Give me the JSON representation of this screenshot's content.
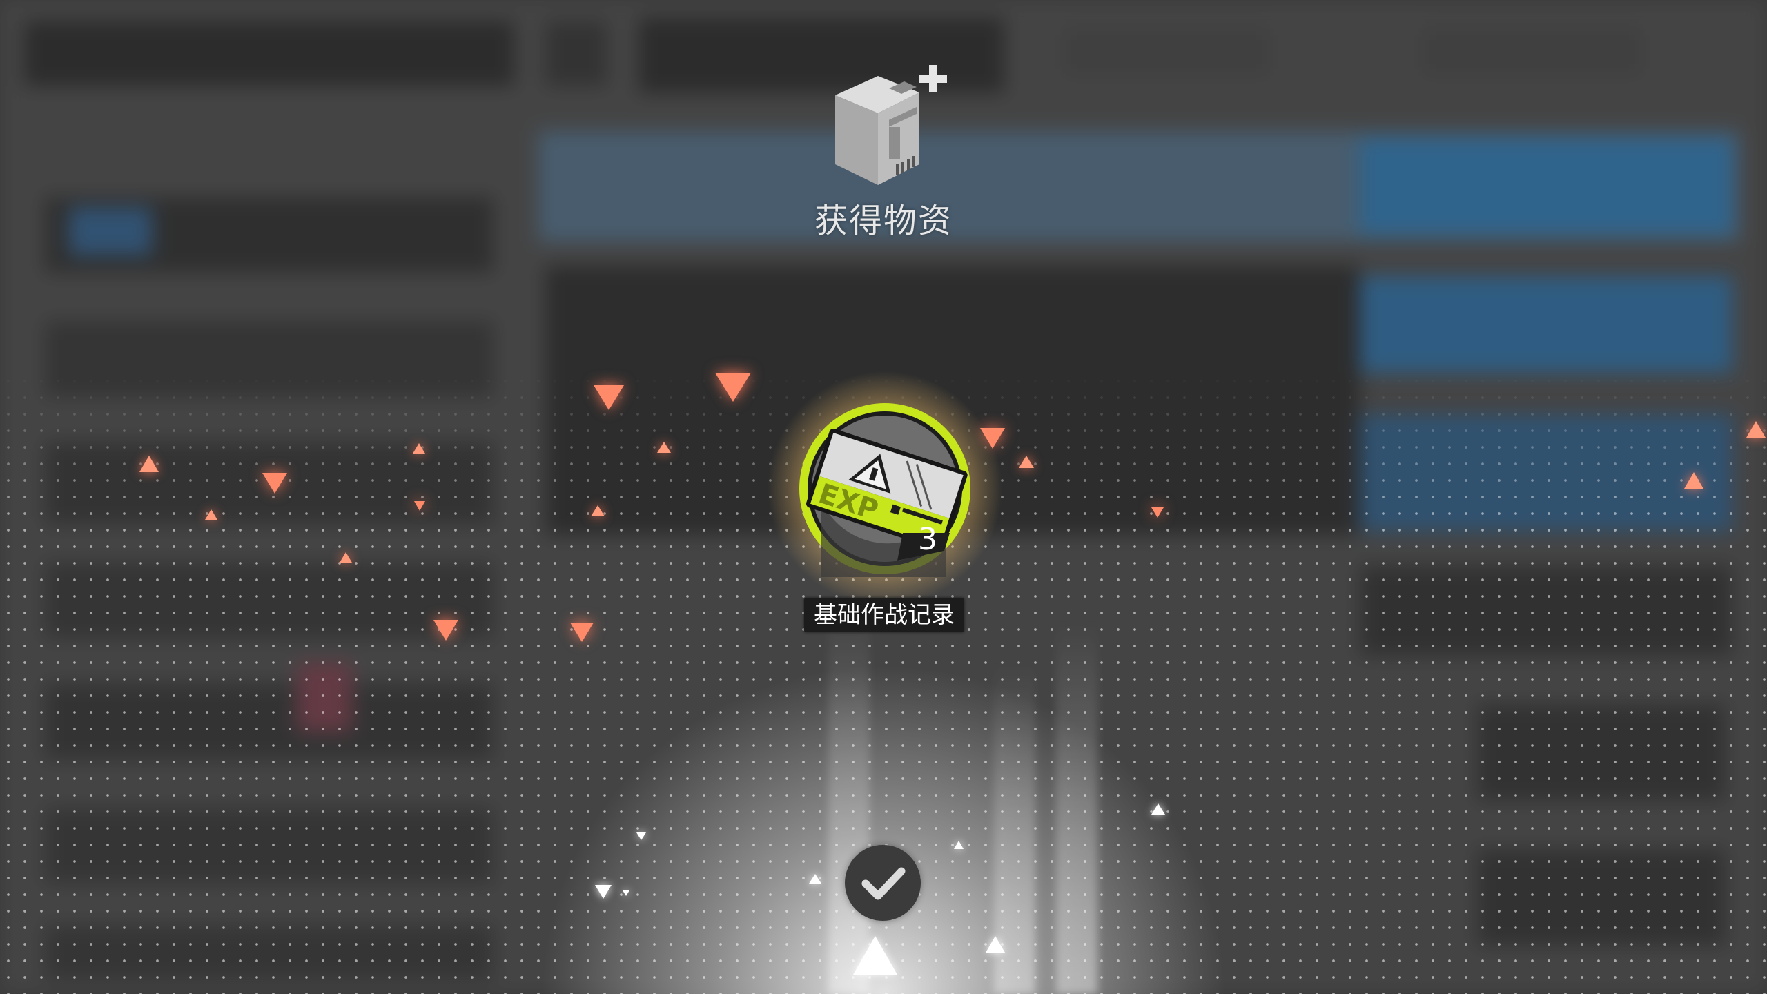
{
  "reward_popup": {
    "title": "获得物资",
    "header_icon": "supply-box-plus-icon",
    "item": {
      "name": "基础作战记录",
      "quantity": "3",
      "icon_label": "EXP",
      "icon": "exp-record-card-icon",
      "ring_color": "#c7e61c"
    },
    "confirm_icon": "checkmark-icon"
  },
  "colors": {
    "particle_orange": "#ff8a6a",
    "particle_white": "#ffffff",
    "overlay": "#5a5a5a"
  }
}
